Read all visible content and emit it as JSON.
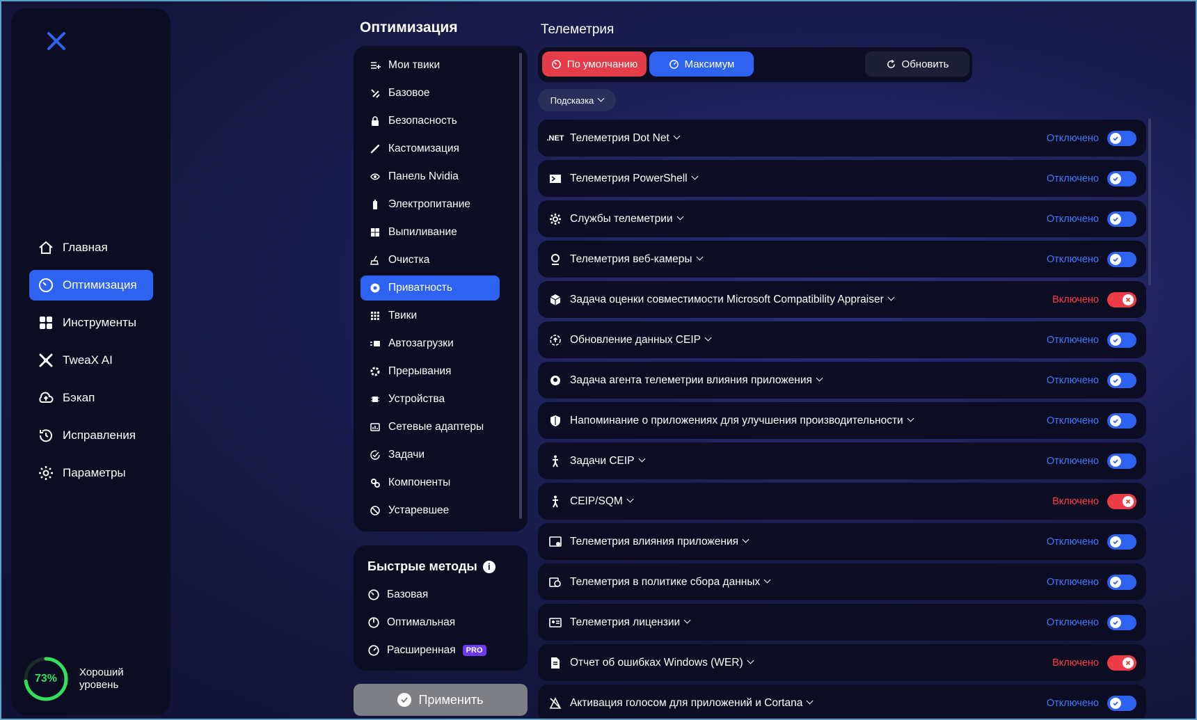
{
  "sidebar": {
    "items": [
      {
        "label": "Главная",
        "icon": "home-icon",
        "active": false
      },
      {
        "label": "Оптимизация",
        "icon": "speedometer-icon",
        "active": true
      },
      {
        "label": "Инструменты",
        "icon": "grid-icon",
        "active": false
      },
      {
        "label": "TweaX AI",
        "icon": "ai-icon",
        "active": false
      },
      {
        "label": "Бэкап",
        "icon": "cloud-upload-icon",
        "active": false
      },
      {
        "label": "Исправления",
        "icon": "history-icon",
        "active": false
      },
      {
        "label": "Параметры",
        "icon": "gear-icon",
        "active": false
      }
    ],
    "score": {
      "value": "73%",
      "level_line1": "Хороший",
      "level_line2": "уровень",
      "color": "#32e05a",
      "fraction": 0.73
    }
  },
  "optimization": {
    "title": "Оптимизация",
    "items": [
      {
        "label": "Мои твики",
        "icon": "list-add-icon"
      },
      {
        "label": "Базовое",
        "icon": "tools-icon"
      },
      {
        "label": "Безопасность",
        "icon": "lock-icon"
      },
      {
        "label": "Кастомизация",
        "icon": "brush-icon"
      },
      {
        "label": "Панель Nvidia",
        "icon": "nvidia-icon"
      },
      {
        "label": "Электропитание",
        "icon": "battery-icon"
      },
      {
        "label": "Выпиливание",
        "icon": "windows-icon"
      },
      {
        "label": "Очистка",
        "icon": "broom-icon"
      },
      {
        "label": "Приватность",
        "icon": "privacy-icon",
        "active": true
      },
      {
        "label": "Твики",
        "icon": "apps-icon"
      },
      {
        "label": "Автозагрузки",
        "icon": "startup-icon"
      },
      {
        "label": "Прерывания",
        "icon": "interrupt-icon"
      },
      {
        "label": "Устройства",
        "icon": "chip-icon"
      },
      {
        "label": "Сетевые адаптеры",
        "icon": "network-icon"
      },
      {
        "label": "Задачи",
        "icon": "task-icon"
      },
      {
        "label": "Компоненты",
        "icon": "components-icon"
      },
      {
        "label": "Устаревшее",
        "icon": "deprecated-icon"
      }
    ]
  },
  "quick": {
    "title": "Быстрые методы",
    "items": [
      {
        "label": "Базовая",
        "icon": "gauge-low-icon"
      },
      {
        "label": "Оптимальная",
        "icon": "gauge-mid-icon"
      },
      {
        "label": "Расширенная",
        "icon": "gauge-high-icon",
        "badge": "PRO"
      }
    ]
  },
  "apply_label": "Применить",
  "panel": {
    "title": "Телеметрия",
    "mode_default": "По умолчанию",
    "mode_max": "Максимум",
    "refresh": "Обновить",
    "hint": "Подсказка"
  },
  "settings": [
    {
      "label": "Телеметрия Dot Net",
      "icon": "dotnet-icon",
      "icon_text": ".NET",
      "status": "Отключено",
      "on": false
    },
    {
      "label": "Телеметрия PowerShell",
      "icon": "powershell-icon",
      "status": "Отключено",
      "on": false
    },
    {
      "label": "Службы телеметрии",
      "icon": "gear-icon",
      "status": "Отключено",
      "on": false
    },
    {
      "label": "Телеметрия веб-камеры",
      "icon": "webcam-icon",
      "status": "Отключено",
      "on": false
    },
    {
      "label": "Задача оценки совместимости Microsoft Compatibility Appraiser",
      "icon": "box-icon",
      "status": "Включено",
      "on": true
    },
    {
      "label": "Обновление данных CEIP",
      "icon": "upload-circle-icon",
      "status": "Отключено",
      "on": false
    },
    {
      "label": "Задача агента телеметрии влияния приложения",
      "icon": "agent-icon",
      "status": "Отключено",
      "on": false
    },
    {
      "label": "Напоминание о приложениях для улучшения производительности",
      "icon": "shield-icon",
      "status": "Отключено",
      "on": false
    },
    {
      "label": "Задачи CEIP",
      "icon": "person-icon",
      "status": "Отключено",
      "on": false
    },
    {
      "label": "CEIP/SQM",
      "icon": "person-icon",
      "status": "Включено",
      "on": true
    },
    {
      "label": "Телеметрия влияния приложения",
      "icon": "window-gear-icon",
      "status": "Отключено",
      "on": false
    },
    {
      "label": "Телеметрия в политике сбора данных",
      "icon": "policy-icon",
      "status": "Отключено",
      "on": false
    },
    {
      "label": "Телеметрия лицензии",
      "icon": "license-icon",
      "status": "Отключено",
      "on": false
    },
    {
      "label": "Отчет об ошибках Windows (WER)",
      "icon": "report-icon",
      "status": "Включено",
      "on": true
    },
    {
      "label": "Активация голосом для приложений и Cortana",
      "icon": "voice-icon",
      "status": "Отключено",
      "on": false
    }
  ]
}
